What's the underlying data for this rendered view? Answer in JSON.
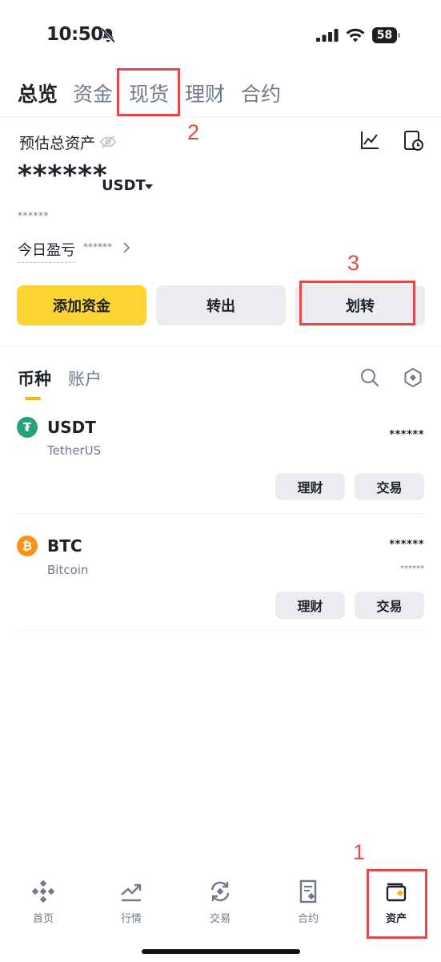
{
  "status_bar": {
    "time": "10:50",
    "battery": "58"
  },
  "top_tabs": [
    {
      "label": "总览",
      "active": true
    },
    {
      "label": "资金",
      "active": false
    },
    {
      "label": "现货",
      "active": false
    },
    {
      "label": "理财",
      "active": false
    },
    {
      "label": "合约",
      "active": false
    }
  ],
  "estimate": {
    "label": "预估总资产",
    "value_masked": "******",
    "unit": "USDT",
    "sub_masked": "******",
    "pnl_label": "今日盈亏",
    "pnl_masked": "******"
  },
  "actions": {
    "add_funds": "添加资金",
    "withdraw": "转出",
    "transfer": "划转"
  },
  "asset_tabs": [
    {
      "label": "币种",
      "active": true
    },
    {
      "label": "账户",
      "active": false
    }
  ],
  "coins": [
    {
      "symbol": "USDT",
      "name": "TetherUS",
      "amount_masked": "******",
      "value_masked": "",
      "btn_earn": "理财",
      "btn_trade": "交易",
      "color": "#26a17b",
      "glyph": "₮"
    },
    {
      "symbol": "BTC",
      "name": "Bitcoin",
      "amount_masked": "******",
      "value_masked": "******",
      "btn_earn": "理财",
      "btn_trade": "交易",
      "color": "#f7931a",
      "glyph": "₿"
    }
  ],
  "bottom_nav": [
    {
      "label": "首页",
      "icon": "binance-logo-icon",
      "active": false
    },
    {
      "label": "行情",
      "icon": "market-chart-icon",
      "active": false
    },
    {
      "label": "交易",
      "icon": "trade-swap-icon",
      "active": false
    },
    {
      "label": "合约",
      "icon": "futures-doc-icon",
      "active": false
    },
    {
      "label": "资产",
      "icon": "wallet-icon",
      "active": true
    }
  ],
  "annotations": [
    "1",
    "2",
    "3"
  ],
  "colors": {
    "accent": "#fcd535",
    "annotation_red": "#e24a4a",
    "text_primary": "#1e2329",
    "text_secondary": "#707a8a"
  }
}
